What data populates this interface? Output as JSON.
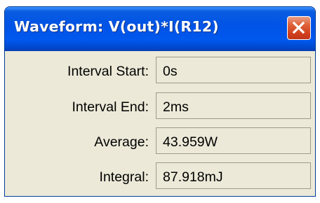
{
  "window": {
    "title": "Waveform: V(out)*I(R12)"
  },
  "fields": [
    {
      "label": "Interval Start:",
      "value": "0s"
    },
    {
      "label": "Interval End:",
      "value": "2ms"
    },
    {
      "label": "Average:",
      "value": "43.959W"
    },
    {
      "label": "Integral:",
      "value": "87.918mJ"
    }
  ],
  "icons": {
    "close": "close-icon"
  },
  "colors": {
    "titlebar": "#0053e5",
    "close_button": "#e0623a",
    "window_body": "#ece9d8"
  }
}
